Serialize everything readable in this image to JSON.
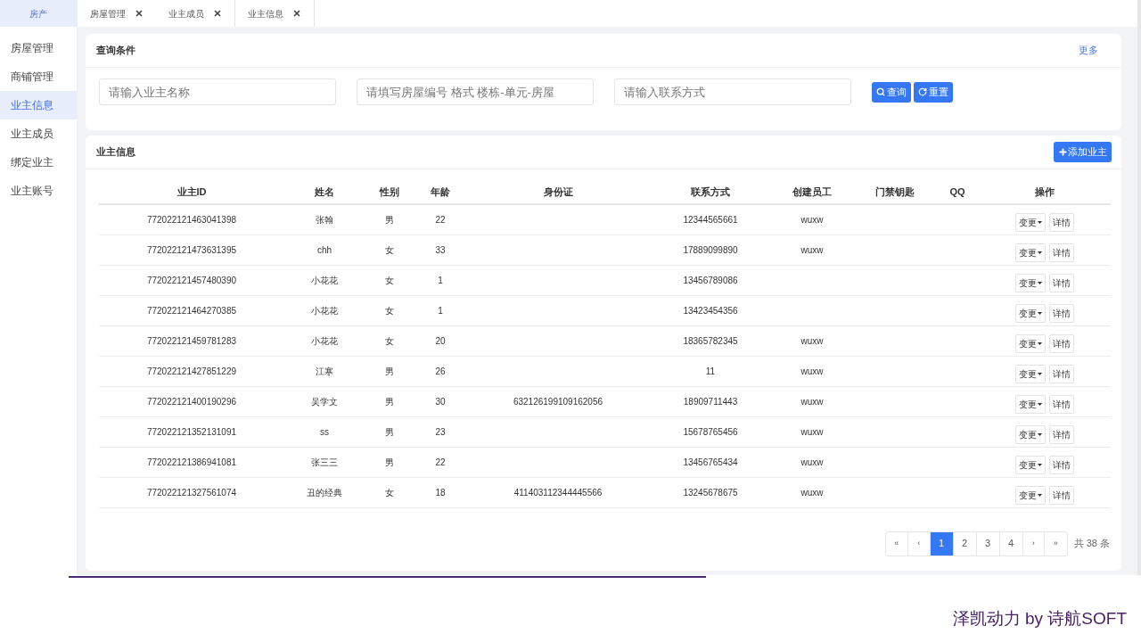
{
  "sidebar": {
    "brand": "房产",
    "items": [
      {
        "label": "房屋管理",
        "selected": false
      },
      {
        "label": "商铺管理",
        "selected": false
      },
      {
        "label": "业主信息",
        "selected": true
      },
      {
        "label": "业主成员",
        "selected": false
      },
      {
        "label": "绑定业主",
        "selected": false
      },
      {
        "label": "业主账号",
        "selected": false
      }
    ]
  },
  "tabs": [
    {
      "label": "房屋管理",
      "selected": false
    },
    {
      "label": "业主成员",
      "selected": false
    },
    {
      "label": "业主信息",
      "selected": true
    }
  ],
  "query": {
    "title": "查询条件",
    "more": "更多",
    "fields": [
      {
        "placeholder": "请输入业主名称"
      },
      {
        "placeholder": "请填写房屋编号 格式 楼栋-单元-房屋"
      },
      {
        "placeholder": "请输入联系方式"
      }
    ],
    "search_button": "查询",
    "reset_button": "重置"
  },
  "table": {
    "title": "业主信息",
    "add_button": "添加业主",
    "columns": [
      "业主ID",
      "姓名",
      "性别",
      "年龄",
      "身份证",
      "联系方式",
      "创建员工",
      "门禁钥匙",
      "QQ",
      "操作"
    ],
    "rows": [
      {
        "id": "772022121463041398",
        "name": "张翰",
        "gender": "男",
        "age": "22",
        "phone": "12344565661",
        "creator": "wuxw",
        "actions": [
          "变更",
          "详情"
        ]
      },
      {
        "id": "772022121473631395",
        "name": "chh",
        "gender": "女",
        "age": "33",
        "phone": "17889099890",
        "creator": "wuxw",
        "actions": [
          "变更",
          "详情"
        ]
      },
      {
        "id": "772022121457480390",
        "name": "小花花",
        "gender": "女",
        "age": "1",
        "phone": "13456789086",
        "actions": [
          "变更",
          "详情"
        ]
      },
      {
        "id": "772022121464270385",
        "name": "小花花",
        "gender": "女",
        "age": "1",
        "phone": "13423454356",
        "actions": [
          "变更",
          "详情"
        ]
      },
      {
        "id": "772022121459781283",
        "name": "小花花",
        "gender": "女",
        "age": "20",
        "phone": "18365782345",
        "creator": "wuxw",
        "actions": [
          "变更",
          "详情"
        ]
      },
      {
        "id": "772022121427851229",
        "name": "江寒",
        "gender": "男",
        "age": "26",
        "phone": "11",
        "creator": "wuxw",
        "actions": [
          "变更",
          "详情"
        ]
      },
      {
        "id": "772022121400190296",
        "name": "吴学文",
        "gender": "男",
        "age": "30",
        "id_card": "632126199109162056",
        "phone": "18909711443",
        "creator": "wuxw",
        "actions": [
          "变更",
          "详情"
        ]
      },
      {
        "id": "772022121352131091",
        "name": "ss",
        "gender": "男",
        "age": "23",
        "phone": "15678765456",
        "creator": "wuxw",
        "actions": [
          "变更",
          "详情"
        ]
      },
      {
        "id": "772022121386941081",
        "name": "张三三",
        "gender": "男",
        "age": "22",
        "phone": "13456765434",
        "creator": "wuxw",
        "actions": [
          "变更",
          "详情"
        ]
      },
      {
        "id": "772022121327561074",
        "name": "丑的经典",
        "gender": "女",
        "age": "18",
        "id_card": "411403112344445566",
        "phone": "13245678675",
        "creator": "wuxw",
        "actions": [
          "变更",
          "详情"
        ]
      }
    ]
  },
  "pagination": {
    "first": "«",
    "prev": "‹",
    "pages": [
      {
        "label": "1",
        "selected": true
      },
      {
        "label": "2",
        "selected": false
      },
      {
        "label": "3",
        "selected": false
      },
      {
        "label": "4",
        "selected": false
      }
    ],
    "next": "›",
    "last": "»",
    "total": "共 38 条"
  },
  "footer": "泽凯动力 by 诗航SOFT"
}
